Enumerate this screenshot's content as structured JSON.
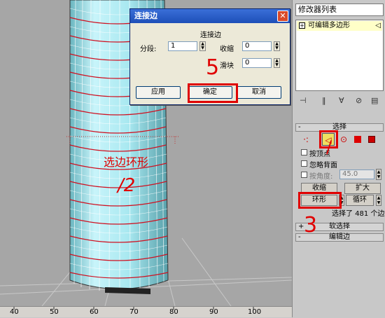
{
  "dialog": {
    "title": "连接边",
    "group_label": "连接边",
    "segments_label": "分段:",
    "segments_value": "1",
    "pinch_label": "收缩",
    "pinch_value": "0",
    "slide_label": "滑块",
    "slide_value": "0",
    "apply_label": "应用",
    "ok_label": "确定",
    "cancel_label": "取消",
    "close_glyph": "✕"
  },
  "panel": {
    "modifier_list": "修改器列表",
    "stack_item_label": "可编辑多边形",
    "selection_header": "选择",
    "by_vertex_label": "按顶点",
    "ignore_backface_label": "忽略背面",
    "by_angle_label": "按角度:",
    "by_angle_value": "45.0",
    "shrink_label": "收缩",
    "grow_label": "扩大",
    "ring_label": "环形",
    "loop_label": "循环",
    "selected_status": "选择了 481 个边",
    "soft_selection_header": "软选择",
    "edit_edges_header": "编辑边",
    "collapse_sign": "-",
    "expand_sign": "+"
  },
  "ruler": {
    "ticks": [
      "40",
      "50",
      "60",
      "70",
      "80",
      "90",
      "100"
    ]
  },
  "annotations": {
    "ring_note": "选边环形",
    "ring_note_number": "/2",
    "step_one": "/",
    "step_three": "3",
    "step_dialog": "5"
  },
  "colors": {
    "annotation_red": "#e00000",
    "cylinder": "#a8e8f0",
    "title_bar": "#1d4fb8"
  }
}
